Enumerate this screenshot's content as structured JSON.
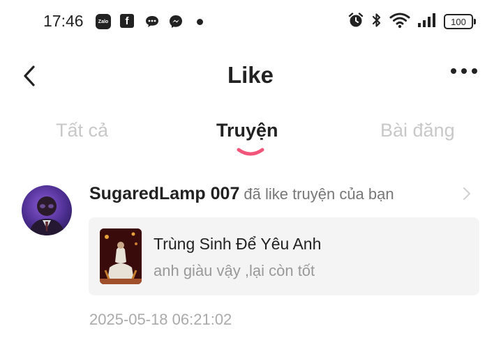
{
  "status_bar": {
    "time": "17:46",
    "zalo_label": "Zalo",
    "fb_label": "f",
    "battery": "100"
  },
  "header": {
    "title": "Like"
  },
  "tabs": [
    {
      "label": "Tất cả",
      "active": false
    },
    {
      "label": "Truyện",
      "active": true
    },
    {
      "label": "Bài đăng",
      "active": false
    }
  ],
  "accent_color": "#f2557a",
  "notifications": [
    {
      "user": "SugaredLamp 007",
      "action": "đã like truyện của bạn",
      "story_title": "Trùng Sinh Để Yêu Anh",
      "story_excerpt": "anh giàu vậy ,lại còn tốt",
      "timestamp": "2025-05-18 06:21:02"
    }
  ]
}
